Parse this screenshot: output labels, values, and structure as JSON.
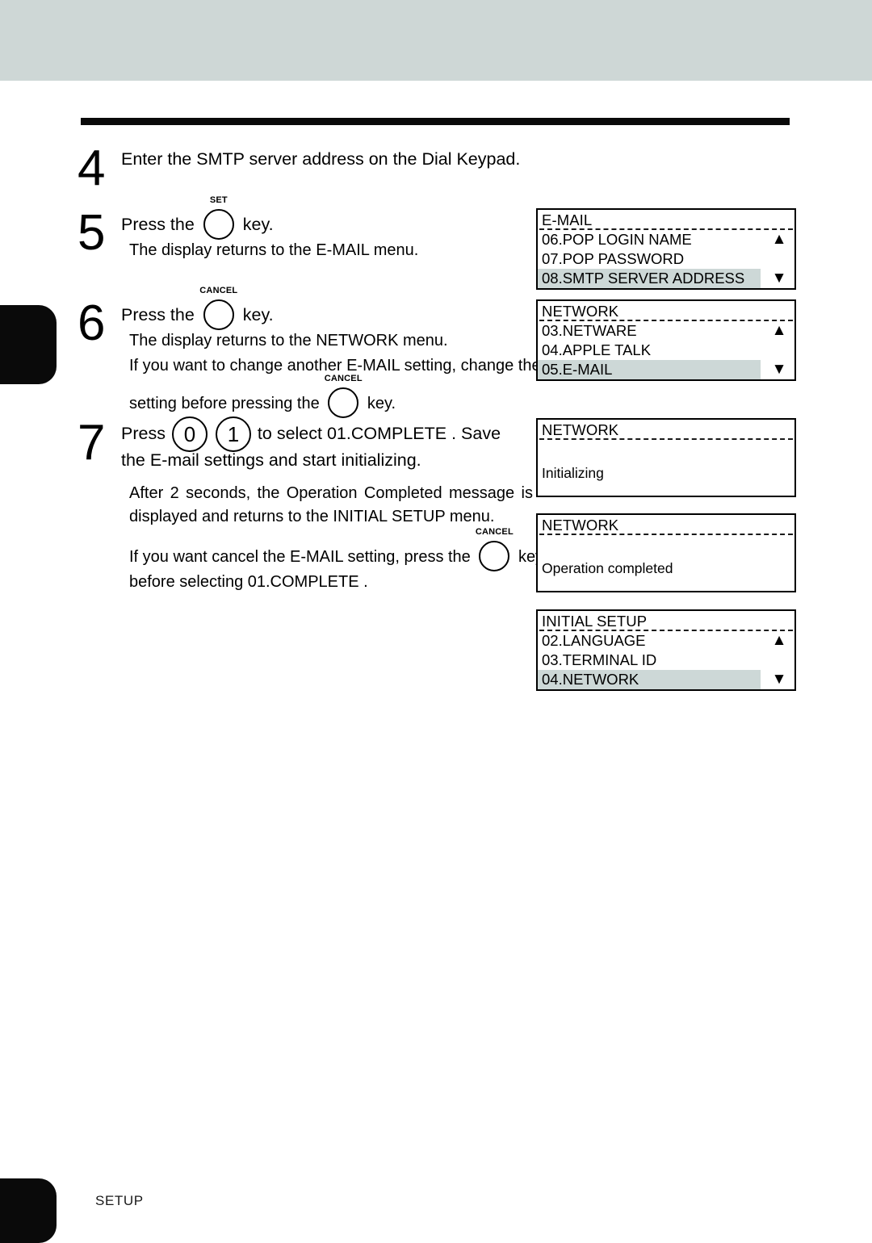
{
  "page": {
    "footer_label": "SETUP",
    "header_band_color": "#ced7d6",
    "rule_color": "#0a0a0a",
    "lcd_highlight_color": "#cdd8d7"
  },
  "steps": [
    {
      "number": "4",
      "lead_before": "Enter the SMTP server address on the Dial Keypad.",
      "lines": []
    },
    {
      "number": "5",
      "lead_before": "Press the",
      "key": "SET",
      "lead_after": "key.",
      "lines": [
        "The display returns to the E-MAIL menu."
      ]
    },
    {
      "number": "6",
      "lead_before": "Press the",
      "key": "CANCEL",
      "lead_after": "key.",
      "lines": [
        "The display returns to the NETWORK menu.",
        "If you want to change another E-MAIL setting, change the",
        "setting before pressing the",
        "key."
      ],
      "inline_key": "CANCEL"
    },
    {
      "number": "7",
      "lead_before": "Press",
      "digit_keys": [
        "0",
        "1"
      ],
      "lead_mid": "to select  01.COMPLETE .   Save",
      "lead_second": "the E-mail settings and start initializing.",
      "lines": [
        "After 2 seconds, the Operation Completed message is displayed and returns to the INITIAL SETUP menu.",
        "If you want cancel the E-MAIL setting, press the",
        "key",
        "before selecting  01.COMPLETE ."
      ],
      "inline_key": "CANCEL"
    }
  ],
  "panels": [
    {
      "id": "email-panel",
      "title": "E-MAIL",
      "rows": [
        {
          "label": "06.POP LOGIN NAME",
          "selected": false,
          "arrow": "up"
        },
        {
          "label": "07.POP PASSWORD",
          "selected": false,
          "arrow": ""
        },
        {
          "label": "08.SMTP SERVER ADDRESS",
          "selected": true,
          "arrow": "down"
        }
      ],
      "arrow_up": "▲",
      "arrow_down": "▼"
    },
    {
      "id": "network-panel",
      "title": "NETWORK",
      "rows": [
        {
          "label": "03.NETWARE",
          "selected": false,
          "arrow": "up"
        },
        {
          "label": "04.APPLE TALK",
          "selected": false,
          "arrow": ""
        },
        {
          "label": "05.E-MAIL",
          "selected": true,
          "arrow": "down"
        }
      ],
      "arrow_up": "▲",
      "arrow_down": "▼"
    },
    {
      "id": "network-initializing-panel",
      "title": "NETWORK",
      "message": "Initializing"
    },
    {
      "id": "network-completed-panel",
      "title": "NETWORK",
      "message": "Operation completed"
    },
    {
      "id": "initial-setup-panel",
      "title": "INITIAL SETUP",
      "rows": [
        {
          "label": "02.LANGUAGE",
          "selected": false,
          "arrow": "up"
        },
        {
          "label": "03.TERMINAL ID",
          "selected": false,
          "arrow": ""
        },
        {
          "label": "04.NETWORK",
          "selected": true,
          "arrow": "down"
        }
      ],
      "arrow_up": "▲",
      "arrow_down": "▼"
    }
  ]
}
